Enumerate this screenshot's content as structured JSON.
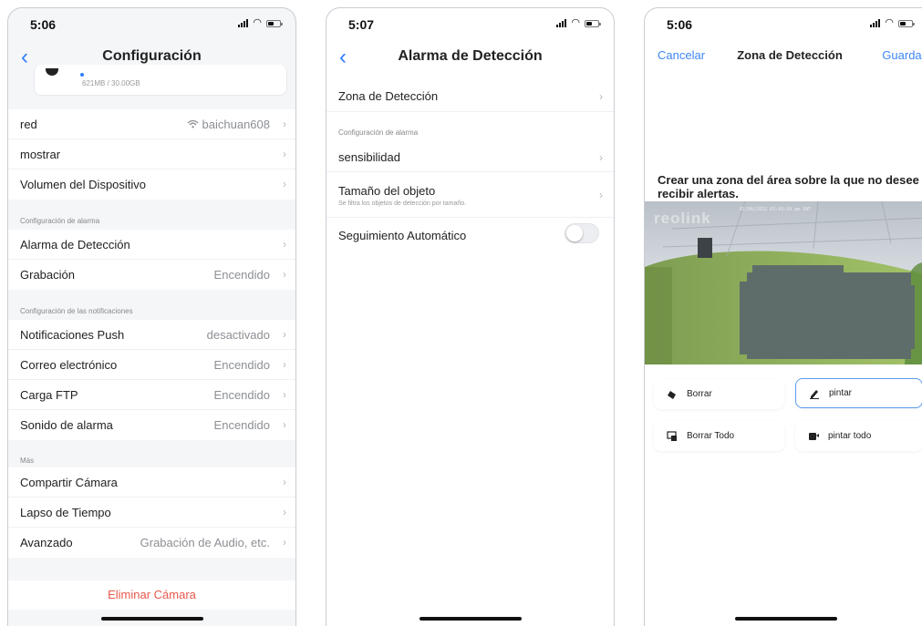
{
  "colors": {
    "accent": "#2f7dfa",
    "danger": "#e8574c",
    "muted": "#8c8f94"
  },
  "phone1": {
    "time": "5:06",
    "title": "Configuración",
    "storage": "621MB / 30.00GB",
    "rows_top": [
      {
        "label": "red",
        "value": "baichuan608",
        "icon": "wifi-icon"
      },
      {
        "label": "mostrar",
        "value": ""
      },
      {
        "label": "Volumen del Dispositivo",
        "value": ""
      }
    ],
    "section_alarm": "Configuración de alarma",
    "rows_alarm": [
      {
        "label": "Alarma de Detección",
        "value": ""
      },
      {
        "label": "Grabación",
        "value": "Encendido"
      }
    ],
    "section_notif": "Configuración de las notificaciones",
    "rows_notif": [
      {
        "label": "Notificaciones Push",
        "value": "desactivado"
      },
      {
        "label": "Correo electrónico",
        "value": "Encendido"
      },
      {
        "label": "Carga FTP",
        "value": "Encendido"
      },
      {
        "label": "Sonido de alarma",
        "value": "Encendido"
      }
    ],
    "section_more": "Más",
    "rows_more": [
      {
        "label": "Compartir Cámara",
        "value": ""
      },
      {
        "label": "Lapso de Tiempo",
        "value": ""
      },
      {
        "label": "Avanzado",
        "value": "Grabación de Audio, etc."
      }
    ],
    "delete_label": "Eliminar Cámara"
  },
  "phone2": {
    "time": "5:07",
    "title": "Alarma de Detección",
    "zone_label": "Zona de Detección",
    "section_alarm": "Configuración de alarma",
    "sensitivity_label": "sensibilidad",
    "object_size_label": "Tamaño del objeto",
    "object_size_sub": "Se filtra los objetos de detección por tamaño.",
    "tracking_label": "Seguimiento Automático",
    "tracking_on": false
  },
  "phone3": {
    "time": "5:06",
    "cancel_label": "Cancelar",
    "title": "Zona de Detección",
    "save_label": "Guardar",
    "instruction": "Crear una zona del área sobre la que no desee recibir alertas.",
    "brand_watermark": "reolink",
    "cam_timestamp": "01/06/2022 03:43:10 pm SAT",
    "tools": [
      {
        "label": "Borrar",
        "icon": "eraser-icon",
        "active": false
      },
      {
        "label": "pintar",
        "icon": "pencil-icon",
        "active": true
      },
      {
        "label": "Borrar Todo",
        "icon": "clear-all-icon",
        "active": false
      },
      {
        "label": "pintar todo",
        "icon": "paint-all-icon",
        "active": false
      }
    ]
  }
}
